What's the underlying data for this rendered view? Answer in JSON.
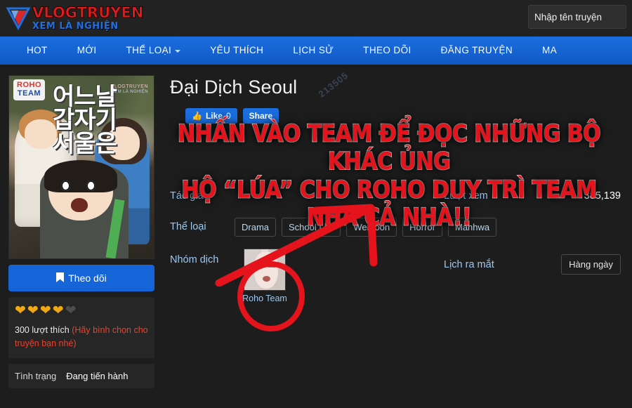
{
  "site": {
    "logo_main": "VLOGTRUYEN",
    "logo_sub": "XEM LÀ NGHIỆN",
    "logo_icon": "play-triangle-icon"
  },
  "search": {
    "placeholder": "Nhập tên truyện",
    "value": ""
  },
  "nav": {
    "items": [
      {
        "label": "HOT",
        "has_caret": false
      },
      {
        "label": "MỚI",
        "has_caret": false
      },
      {
        "label": "THỂ LOẠI",
        "has_caret": true
      },
      {
        "label": "YÊU THÍCH",
        "has_caret": false
      },
      {
        "label": "LỊCH SỬ",
        "has_caret": false
      },
      {
        "label": "THEO DÕI",
        "has_caret": false
      },
      {
        "label": "ĐĂNG TRUYỆN",
        "has_caret": false
      },
      {
        "label": "MA",
        "has_caret": false
      }
    ]
  },
  "cover": {
    "badge_line1": "ROHO",
    "badge_line2": "TEAM",
    "korean_title_line1": "어느날",
    "korean_title_line2": "갑자기",
    "korean_title_line3": "서울은",
    "watermark_line1": "VLOGTRUYEN",
    "watermark_line2": "XEM LÀ NGHIỆN"
  },
  "comic": {
    "title": "Đại Dịch Seoul",
    "page_watermark": "213505",
    "follow_label": "Theo dõi",
    "follow_icon": "bookmark-icon",
    "hearts_filled": 4,
    "hearts_total": 5,
    "likes_count_text": "300 lượt thích",
    "likes_hint": "(Hãy bình chọn cho truyện bạn nhé)",
    "status_label": "Tình trạng",
    "status_value": "Đang tiến hành"
  },
  "social": {
    "like_label": "Like",
    "like_count": "0",
    "like_icon": "thumbs-up-icon",
    "share_label": "Share"
  },
  "meta": {
    "author_label": "Tác giả",
    "author_value": "",
    "views_label": "Lượt xem",
    "views_value": "385,139",
    "genres_label": "Thể loại",
    "genres": [
      "Drama",
      "School Life",
      "Webtoon",
      "Horror",
      "Manhwa"
    ],
    "team_label": "Nhóm dịch",
    "team_name": "Roho Team",
    "schedule_label": "Lịch ra mắt",
    "schedule_value": "Hàng ngày"
  },
  "annotation": {
    "line1": "NHẤN VÀO TEAM ĐỂ ĐỌC NHỮNG BỘ KHÁC ỦNG",
    "line2": "HỘ “LÚA” CHO ROHO DUY TRÌ TEAM NHA CẢ NHÀ!!",
    "color": "#e5131c"
  },
  "colors": {
    "nav_blue": "#1565d8",
    "accent_red": "#e5131c",
    "label_blue": "#9fc8ef",
    "heart_gold": "#f0a913",
    "page_bg": "#1d1d1d"
  }
}
